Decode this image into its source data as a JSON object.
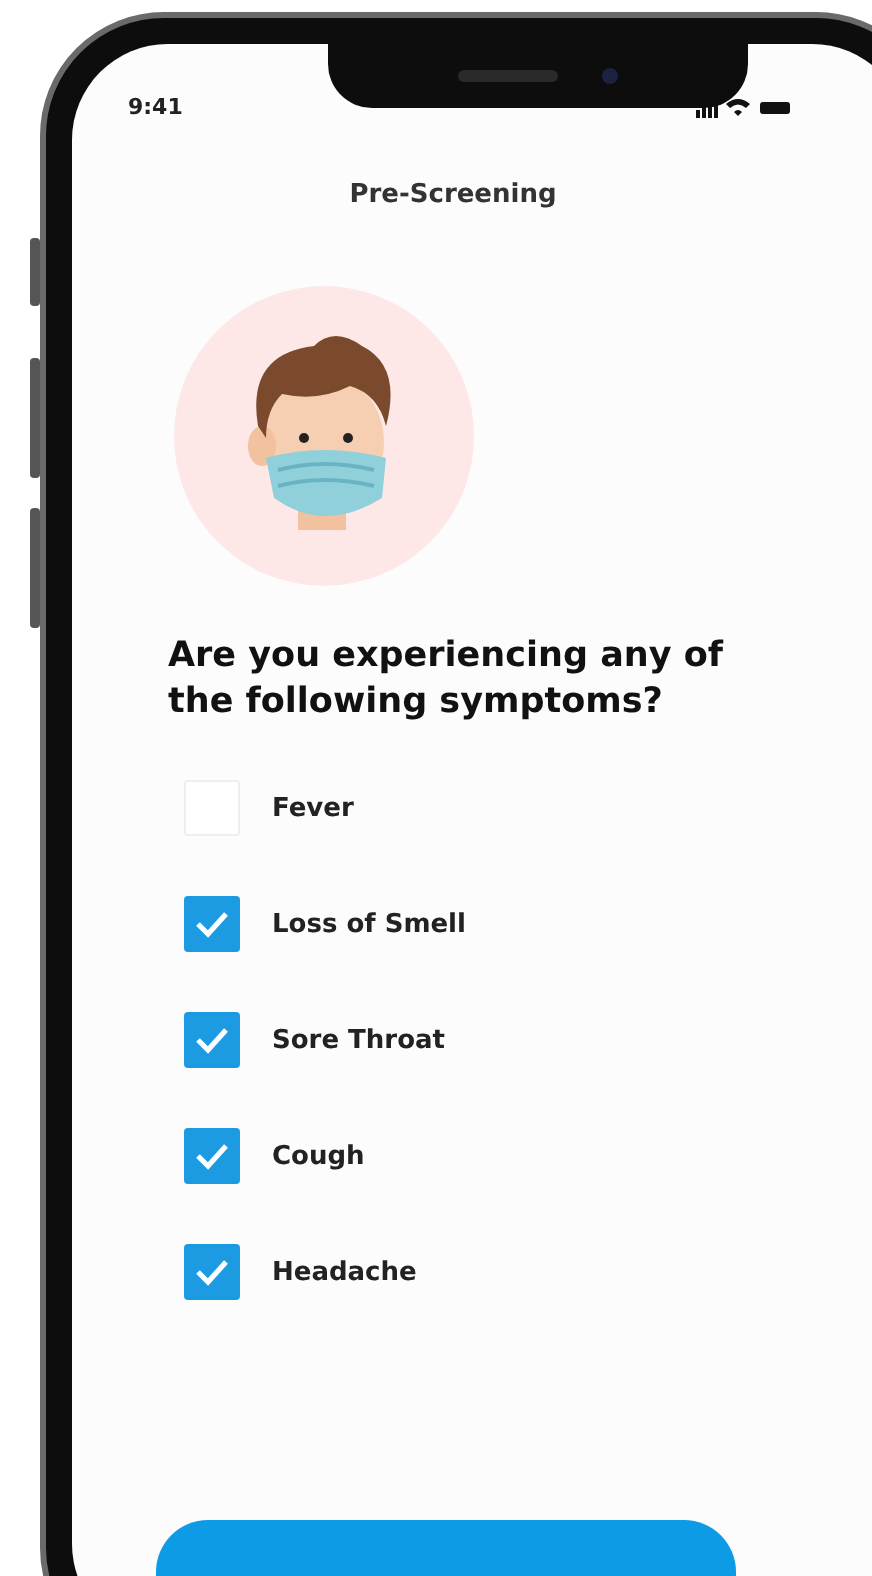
{
  "status_bar": {
    "time": "9:41"
  },
  "header": {
    "title": "Pre-Screening"
  },
  "question": "Are you experiencing any of the following symptoms?",
  "symptoms": [
    {
      "label": "Fever",
      "checked": false
    },
    {
      "label": "Loss of Smell",
      "checked": true
    },
    {
      "label": "Sore Throat",
      "checked": true
    },
    {
      "label": "Cough",
      "checked": true
    },
    {
      "label": "Headache",
      "checked": true
    }
  ]
}
